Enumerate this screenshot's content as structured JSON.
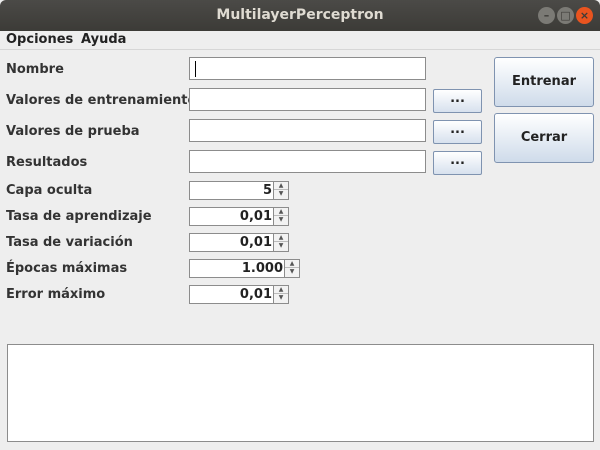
{
  "window": {
    "title": "MultilayerPerceptron",
    "controls": {
      "minimize": "–",
      "maximize": "□",
      "close": "×"
    }
  },
  "menu": {
    "items": [
      "Opciones",
      "Ayuda"
    ]
  },
  "form": {
    "fields": [
      {
        "label": "Nombre",
        "value": ""
      },
      {
        "label": "Valores de entrenamiento",
        "value": "",
        "browse": "..."
      },
      {
        "label": "Valores de prueba",
        "value": "",
        "browse": "..."
      },
      {
        "label": "Resultados",
        "value": "",
        "browse": "..."
      }
    ],
    "spinners": [
      {
        "label": "Capa oculta",
        "value": "5"
      },
      {
        "label": "Tasa de aprendizaje",
        "value": "0,01"
      },
      {
        "label": "Tasa de variación",
        "value": "0,01"
      },
      {
        "label": "Épocas máximas",
        "value": "1.000"
      },
      {
        "label": "Error máximo",
        "value": "0,01"
      }
    ]
  },
  "actions": {
    "train": "Entrenar",
    "close": "Cerrar"
  },
  "output": {
    "text": ""
  },
  "icons": {
    "spin_up": "▲",
    "spin_down": "▼"
  }
}
